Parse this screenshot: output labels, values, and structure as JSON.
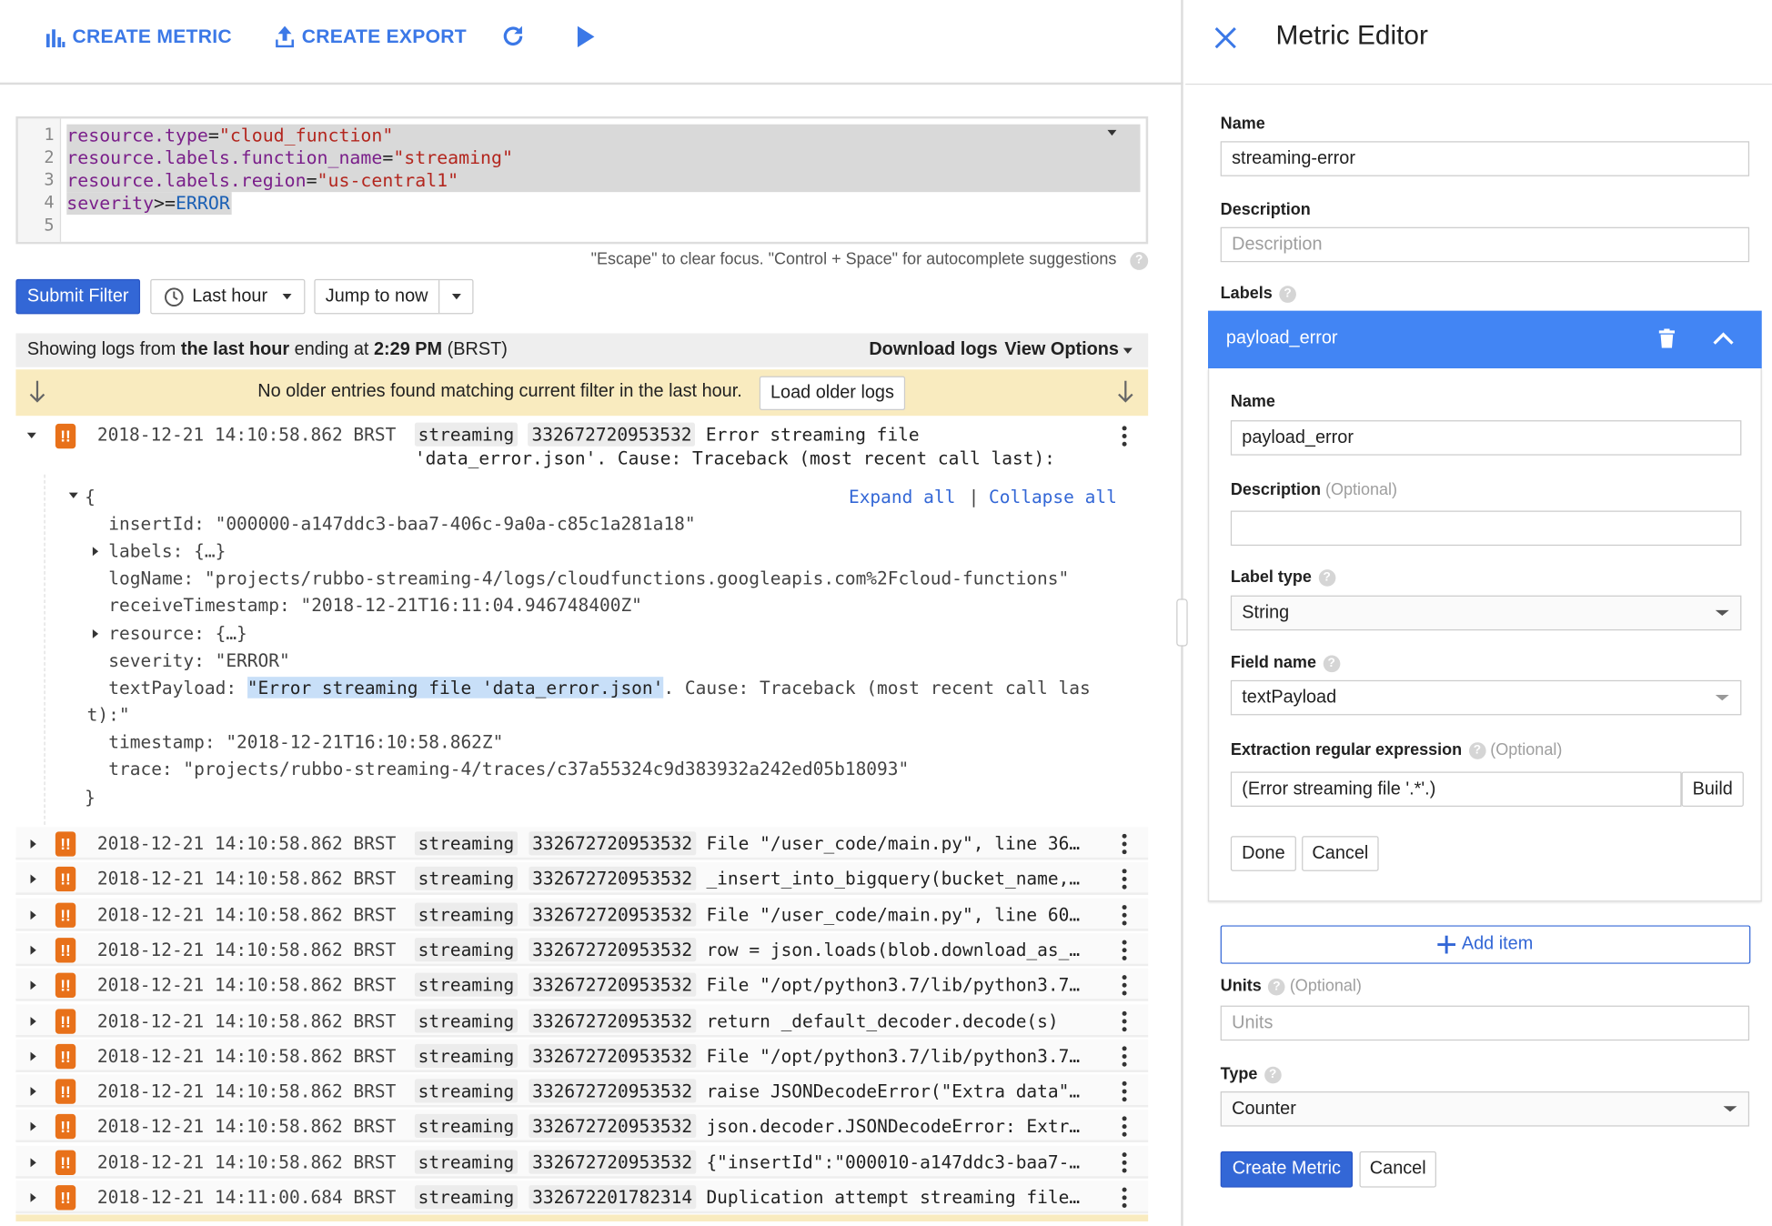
{
  "toolbar": {
    "create_metric": "CREATE METRIC",
    "create_export": "CREATE EXPORT",
    "refresh_icon": "refresh-icon",
    "play_icon": "play-icon"
  },
  "filter": {
    "lines": [
      {
        "n": "1",
        "key": "resource.type",
        "op": "=",
        "val": "\"cloud_function\""
      },
      {
        "n": "2",
        "key": "resource.labels.function_name",
        "op": "=",
        "val": "\"streaming\""
      },
      {
        "n": "3",
        "key": "resource.labels.region",
        "op": "=",
        "val": "\"us-central1\""
      },
      {
        "n": "4",
        "key": "severity",
        "op": ">=",
        "val": "ERROR"
      },
      {
        "n": "5",
        "key": "",
        "op": "",
        "val": ""
      }
    ],
    "hint": "\"Escape\" to clear focus. \"Control + Space\" for autocomplete suggestions"
  },
  "controls": {
    "submit": "Submit Filter",
    "time_range": "Last hour",
    "jump": "Jump to now"
  },
  "status": {
    "prefix": "Showing logs from ",
    "range": "the last hour",
    "mid": " ending at ",
    "time": "2:29 PM",
    "tz": " (BRST)",
    "download": "Download logs",
    "view_options": "View Options"
  },
  "notice": {
    "text": "No older entries found matching current filter in the last hour.",
    "load_older": "Load older logs"
  },
  "expanded": {
    "timestamp": "2018-12-21 14:10:58.862 BRST",
    "function": "streaming",
    "execution_id": "332672720953532",
    "summary": "Error streaming file 'data_error.json'. Cause: Traceback (most recent call last):",
    "expand_all": "Expand all",
    "sep": "|",
    "collapse_all": "Collapse all",
    "open_brace": "{",
    "close_brace": "}",
    "fields": {
      "insertId": "insertId: \"000000-a147ddc3-baa7-406c-9a0a-c85c1a281a18\"",
      "labels": "labels: {…}",
      "logName": "logName: \"projects/rubbo-streaming-4/logs/cloudfunctions.googleapis.com%2Fcloud-functions\"",
      "receiveTimestamp": "receiveTimestamp: \"2018-12-21T16:11:04.946748400Z\"",
      "resource": "resource: {…}",
      "severity": "severity: \"ERROR\"",
      "textPayload_key": "textPayload: ",
      "textPayload_highlight": "\"Error streaming file 'data_error.json'",
      "textPayload_rest": ". Cause: Traceback (most recent call last):\"",
      "timestamp": "timestamp: \"2018-12-21T16:10:58.862Z\"",
      "trace": "trace: \"projects/rubbo-streaming-4/traces/c37a55324c9d383932a242ed05b18093\""
    }
  },
  "log_rows": [
    {
      "ts": "2018-12-21 14:10:58.862 BRST",
      "fn": "streaming",
      "id": "332672720953532",
      "msg": "File \"/user_code/main.py\", line 36…"
    },
    {
      "ts": "2018-12-21 14:10:58.862 BRST",
      "fn": "streaming",
      "id": "332672720953532",
      "msg": "_insert_into_bigquery(bucket_name,…"
    },
    {
      "ts": "2018-12-21 14:10:58.862 BRST",
      "fn": "streaming",
      "id": "332672720953532",
      "msg": "File \"/user_code/main.py\", line 60…"
    },
    {
      "ts": "2018-12-21 14:10:58.862 BRST",
      "fn": "streaming",
      "id": "332672720953532",
      "msg": "row = json.loads(blob.download_as_…"
    },
    {
      "ts": "2018-12-21 14:10:58.862 BRST",
      "fn": "streaming",
      "id": "332672720953532",
      "msg": "File \"/opt/python3.7/lib/python3.7…"
    },
    {
      "ts": "2018-12-21 14:10:58.862 BRST",
      "fn": "streaming",
      "id": "332672720953532",
      "msg": "return _default_decoder.decode(s)"
    },
    {
      "ts": "2018-12-21 14:10:58.862 BRST",
      "fn": "streaming",
      "id": "332672720953532",
      "msg": "File \"/opt/python3.7/lib/python3.7…"
    },
    {
      "ts": "2018-12-21 14:10:58.862 BRST",
      "fn": "streaming",
      "id": "332672720953532",
      "msg": "raise JSONDecodeError(\"Extra data\"…"
    },
    {
      "ts": "2018-12-21 14:10:58.862 BRST",
      "fn": "streaming",
      "id": "332672720953532",
      "msg": "json.decoder.JSONDecodeError: Extr…"
    },
    {
      "ts": "2018-12-21 14:10:58.862 BRST",
      "fn": "streaming",
      "id": "332672720953532",
      "msg": "{\"insertId\":\"000010-a147ddc3-baa7-…"
    },
    {
      "ts": "2018-12-21 14:11:00.684 BRST",
      "fn": "streaming",
      "id": "332672201782314",
      "msg": "Duplication attempt streaming file…"
    }
  ],
  "severity_icon_text": "!!",
  "editor": {
    "title": "Metric Editor",
    "name_label": "Name",
    "name_value": "streaming-error",
    "description_label": "Description",
    "description_placeholder": "Description",
    "labels_label": "Labels",
    "label_item": {
      "title": "payload_error",
      "name_label": "Name",
      "name_value": "payload_error",
      "description_label": "Description",
      "optional": "(Optional)",
      "description_value": "",
      "label_type_label": "Label type",
      "label_type_value": "String",
      "field_name_label": "Field name",
      "field_name_value": "textPayload",
      "regex_label": "Extraction regular expression",
      "regex_value": "(Error streaming file '.*'.)",
      "build": "Build",
      "done": "Done",
      "cancel": "Cancel"
    },
    "add_item": "Add item",
    "units_label": "Units",
    "units_placeholder": "Units",
    "type_label": "Type",
    "type_value": "Counter",
    "create": "Create Metric",
    "cancel": "Cancel"
  },
  "colors": {
    "accent": "#4285f4",
    "primary_button": "#3367d6",
    "severity_error": "#e8711a",
    "notice_bg": "#f9ebbf"
  }
}
